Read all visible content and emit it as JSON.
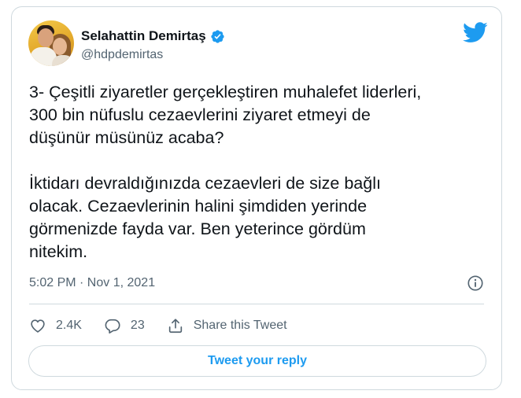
{
  "author": {
    "display_name": "Selahattin Demirtaş",
    "handle": "@hdpdemirtas",
    "verified": true,
    "avatar_icon": "profile-photo"
  },
  "brand": {
    "icon": "twitter-bird-icon",
    "color": "#1d9bf0"
  },
  "tweet": {
    "paragraphs": [
      "3- Çeşitli ziyaretler gerçekleştiren muhalefet liderleri,\n300 bin nüfuslu cezaevlerini ziyaret etmeyi de\ndüşünür müsünüz acaba?",
      "İktidarı devraldığınızda cezaevleri de size bağlı\nolacak. Cezaevlerinin halini şimdiden yerinde\ngörmenizde fayda var. Ben yeterince gördüm\nnitekim."
    ],
    "timestamp": "5:02 PM · Nov 1, 2021"
  },
  "actions": {
    "likes": "2.4K",
    "replies": "23",
    "share_label": "Share this Tweet"
  },
  "reply_button_label": "Tweet your reply",
  "colors": {
    "text": "#0f1419",
    "secondary": "#536471",
    "border": "#cfd9de",
    "accent": "#1d9bf0"
  }
}
